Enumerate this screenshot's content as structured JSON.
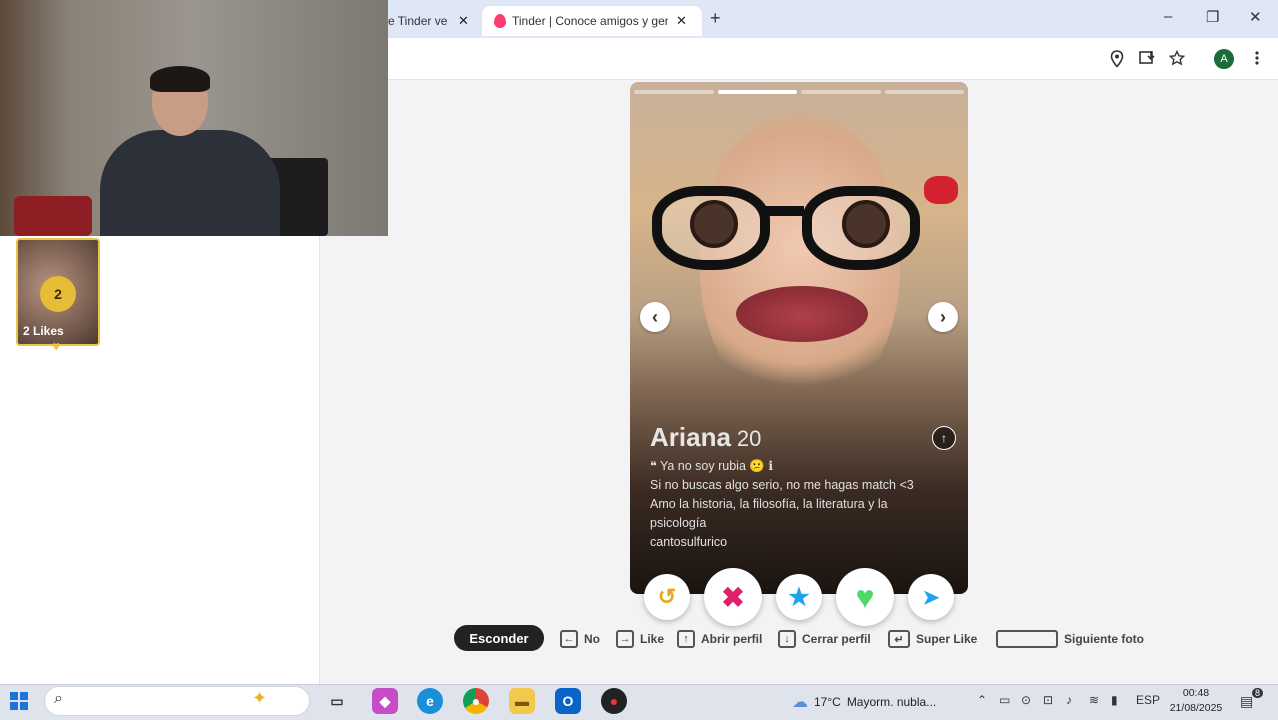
{
  "browser": {
    "tabs": [
      {
        "label": "e Tinder ve",
        "close": "✕"
      },
      {
        "label": "Tinder | Conoce amigos y gente",
        "close": "✕"
      }
    ],
    "new_tab": "+",
    "window_controls": {
      "minimize": "–",
      "restore": "❐",
      "close": "✕"
    },
    "profile_initial": "A",
    "toolbar_icons": [
      "location-icon",
      "install-icon",
      "bookmark-star-icon",
      "menu-kebab-icon"
    ]
  },
  "sidebar": {
    "likes_count": "2",
    "likes_label": "2 Likes"
  },
  "profile": {
    "name": "Ariana",
    "age": "20",
    "photo_progress": {
      "total": 4,
      "current": 2
    },
    "bio_lines": [
      "❝ Ya no soy rubia 😕 ℹ",
      "Si no buscas algo serio, no me hagas match <3",
      "Amo la historia, la filosofía, la literatura y la",
      "psicología",
      "cantosulfurico"
    ],
    "prev_arrow": "‹",
    "next_arrow": "›",
    "expand_arrow": "↑"
  },
  "actions": {
    "rewind": "↺",
    "nope": "✖",
    "super_like": "★",
    "like": "♥",
    "boost": "➤"
  },
  "shortcuts": {
    "hide_label": "Esconder",
    "items": [
      {
        "key": "←",
        "label": "No"
      },
      {
        "key": "→",
        "label": "Like"
      },
      {
        "key": "↑",
        "label": "Abrir perfil"
      },
      {
        "key": "↓",
        "label": "Cerrar perfil"
      },
      {
        "key": "↵",
        "label": "Super Like"
      },
      {
        "key": "",
        "label": "Siguiente foto"
      }
    ]
  },
  "taskbar": {
    "weather_temp": "17°C",
    "weather_text": "Mayorm. nubla...",
    "language": "ESP",
    "time": "00:48",
    "date": "21/08/2025",
    "notification_count": "8"
  },
  "colors": {
    "tinder_pink": "#fe3c72",
    "like_green": "#4cd964",
    "nope_pink": "#e0206b",
    "super_blue": "#1ea2f2",
    "rewind_gold": "#e6a817",
    "likes_gold": "#e7bd38"
  }
}
